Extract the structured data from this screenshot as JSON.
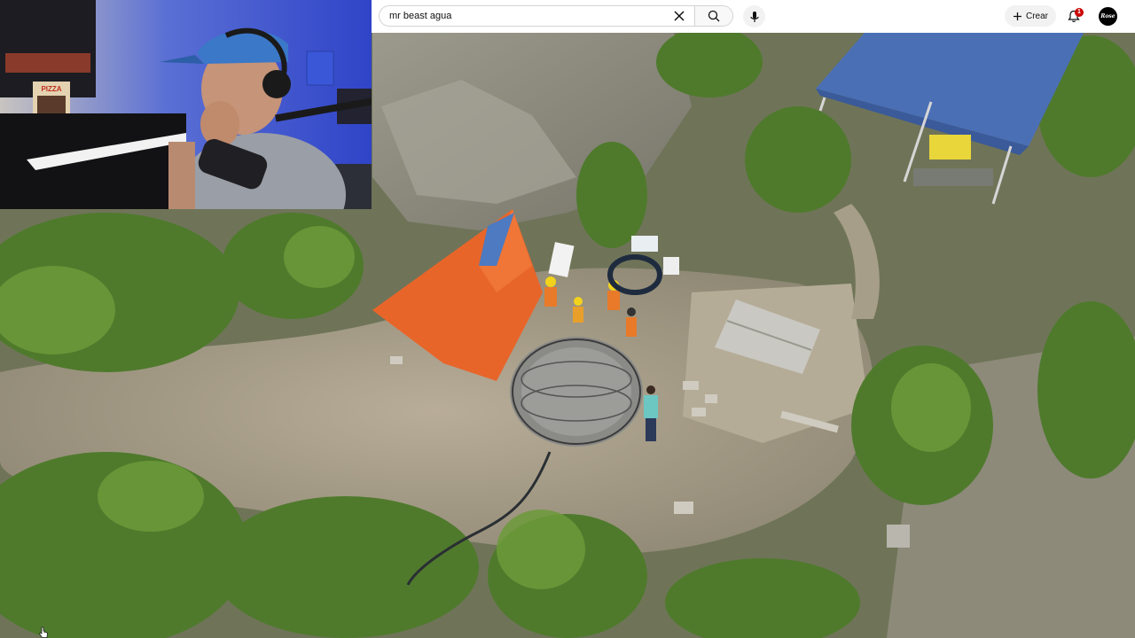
{
  "search": {
    "value": "mr beast agua"
  },
  "header": {
    "create_label": "Crear",
    "notification_count": "1",
    "avatar_text": "Rose"
  },
  "webcam": {
    "poster_text": "PIZZA"
  },
  "icons": {
    "clear": "close-icon",
    "search": "search-icon",
    "mic": "mic-icon",
    "create": "plus-icon",
    "notifications": "bell-icon"
  },
  "colors": {
    "tarp": "#e8652a",
    "canopy": "#4a6fb5",
    "badge": "#cc0000"
  }
}
